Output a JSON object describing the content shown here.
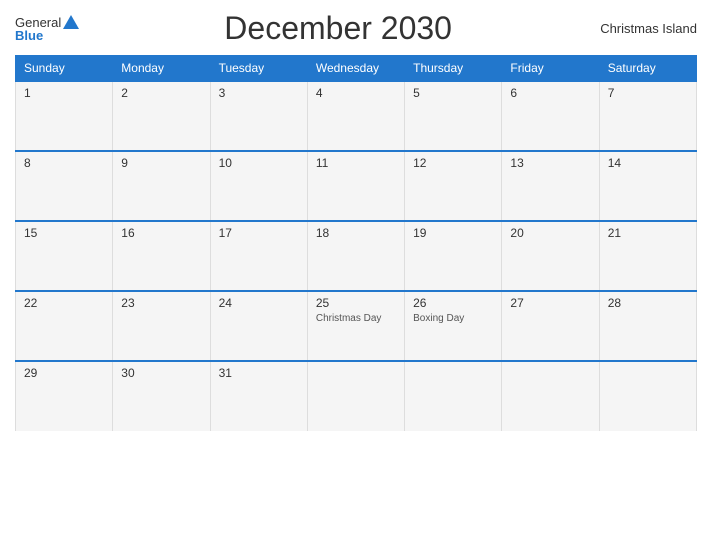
{
  "header": {
    "logo_general": "General",
    "logo_blue": "Blue",
    "title": "December 2030",
    "region": "Christmas Island"
  },
  "weekdays": [
    "Sunday",
    "Monday",
    "Tuesday",
    "Wednesday",
    "Thursday",
    "Friday",
    "Saturday"
  ],
  "weeks": [
    [
      {
        "day": "1",
        "holiday": ""
      },
      {
        "day": "2",
        "holiday": ""
      },
      {
        "day": "3",
        "holiday": ""
      },
      {
        "day": "4",
        "holiday": ""
      },
      {
        "day": "5",
        "holiday": ""
      },
      {
        "day": "6",
        "holiday": ""
      },
      {
        "day": "7",
        "holiday": ""
      }
    ],
    [
      {
        "day": "8",
        "holiday": ""
      },
      {
        "day": "9",
        "holiday": ""
      },
      {
        "day": "10",
        "holiday": ""
      },
      {
        "day": "11",
        "holiday": ""
      },
      {
        "day": "12",
        "holiday": ""
      },
      {
        "day": "13",
        "holiday": ""
      },
      {
        "day": "14",
        "holiday": ""
      }
    ],
    [
      {
        "day": "15",
        "holiday": ""
      },
      {
        "day": "16",
        "holiday": ""
      },
      {
        "day": "17",
        "holiday": ""
      },
      {
        "day": "18",
        "holiday": ""
      },
      {
        "day": "19",
        "holiday": ""
      },
      {
        "day": "20",
        "holiday": ""
      },
      {
        "day": "21",
        "holiday": ""
      }
    ],
    [
      {
        "day": "22",
        "holiday": ""
      },
      {
        "day": "23",
        "holiday": ""
      },
      {
        "day": "24",
        "holiday": ""
      },
      {
        "day": "25",
        "holiday": "Christmas Day"
      },
      {
        "day": "26",
        "holiday": "Boxing Day"
      },
      {
        "day": "27",
        "holiday": ""
      },
      {
        "day": "28",
        "holiday": ""
      }
    ],
    [
      {
        "day": "29",
        "holiday": ""
      },
      {
        "day": "30",
        "holiday": ""
      },
      {
        "day": "31",
        "holiday": ""
      },
      {
        "day": "",
        "holiday": ""
      },
      {
        "day": "",
        "holiday": ""
      },
      {
        "day": "",
        "holiday": ""
      },
      {
        "day": "",
        "holiday": ""
      }
    ]
  ]
}
